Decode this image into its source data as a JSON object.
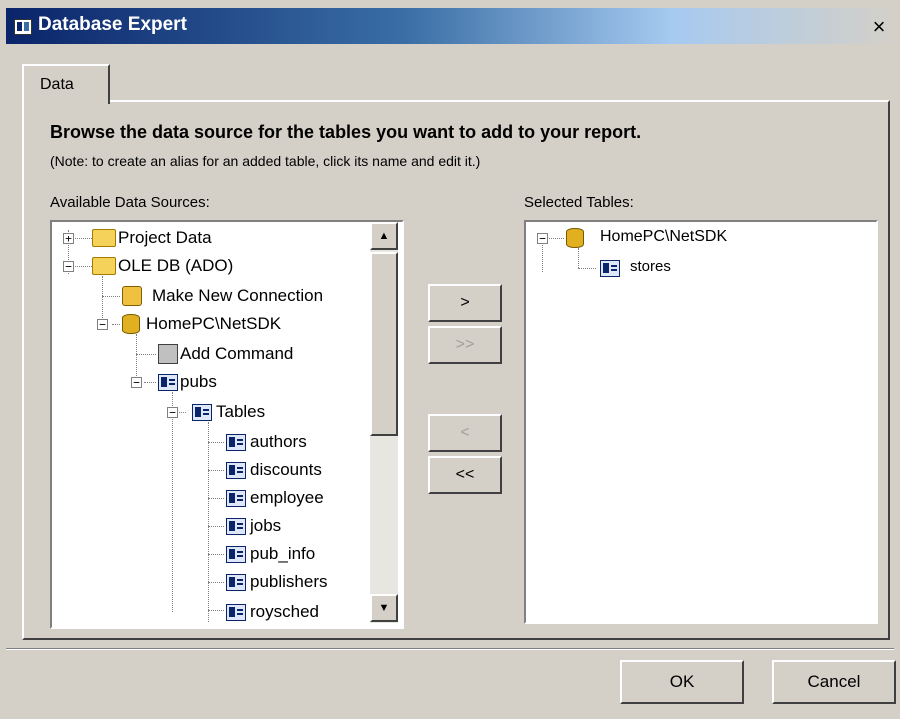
{
  "window": {
    "title": "Database Expert",
    "close": "×"
  },
  "tabs": [
    {
      "label": "Data"
    }
  ],
  "heading": "Browse the data source for the tables you want to add to your report.",
  "note": "(Note: to create an alias for an added table, click its name and edit it.)",
  "available": {
    "label": "Available Data Sources:",
    "nodes": [
      {
        "label": "Project Data",
        "icon": "folder-icon",
        "expander": "+"
      },
      {
        "label": "OLE DB (ADO)",
        "icon": "folder-icon",
        "expander": "−"
      },
      {
        "label": "Make New Connection",
        "icon": "connection-icon"
      },
      {
        "label": "HomePC\\NetSDK",
        "icon": "database-icon",
        "expander": "−"
      },
      {
        "label": "Add Command",
        "icon": "command-icon"
      },
      {
        "label": "pubs",
        "icon": "table-icon",
        "expander": "−"
      },
      {
        "label": "Tables",
        "icon": "table-icon",
        "expander": "−"
      },
      {
        "label": "authors",
        "icon": "table-icon"
      },
      {
        "label": "discounts",
        "icon": "table-icon"
      },
      {
        "label": "employee",
        "icon": "table-icon"
      },
      {
        "label": "jobs",
        "icon": "table-icon"
      },
      {
        "label": "pub_info",
        "icon": "table-icon"
      },
      {
        "label": "publishers",
        "icon": "table-icon"
      },
      {
        "label": "roysched",
        "icon": "table-icon"
      }
    ]
  },
  "selected": {
    "label": "Selected Tables:",
    "nodes": [
      {
        "label": "HomePC\\NetSDK",
        "icon": "database-icon",
        "expander": "−"
      },
      {
        "label": "stores",
        "icon": "table-icon"
      }
    ]
  },
  "move_buttons": {
    "add_one": ">",
    "add_all": ">>",
    "remove_one": "<",
    "remove_all": "<<"
  },
  "scrollbar": {
    "up": "▲",
    "down": "▼"
  },
  "dialog_buttons": {
    "ok": "OK",
    "cancel": "Cancel"
  }
}
